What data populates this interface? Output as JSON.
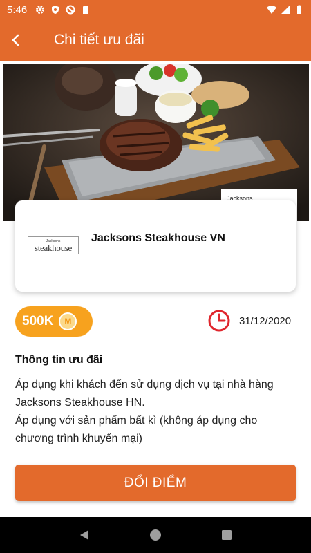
{
  "status_bar": {
    "time": "5:46"
  },
  "header": {
    "title": "Chi tiết ưu đãi"
  },
  "hero": {
    "label": "Jacksons"
  },
  "merchant": {
    "logo_small": "Jacksons",
    "logo_big": "steakhouse",
    "name": "Jacksons Steakhouse VN"
  },
  "offer": {
    "points": "500K",
    "coin_letter": "M",
    "expiry": "31/12/2020"
  },
  "info": {
    "title": "Thông tin ưu đãi",
    "body": "Áp dụng khi khách đến sử dụng dịch vụ tại nhà hàng Jacksons Steakhouse HN.\nÁp dụng với sản phẩm bất kì (không áp dụng cho chương trình khuyến mại)"
  },
  "actions": {
    "redeem_label": "ĐỔI ĐIỂM"
  },
  "colors": {
    "accent": "#e36a2c",
    "points": "#f7a21e",
    "clock": "#e0262d"
  },
  "icons": [
    "back-arrow-icon",
    "clock-icon",
    "m-coin-icon",
    "nav-back-icon",
    "nav-home-icon",
    "nav-recents-icon"
  ]
}
